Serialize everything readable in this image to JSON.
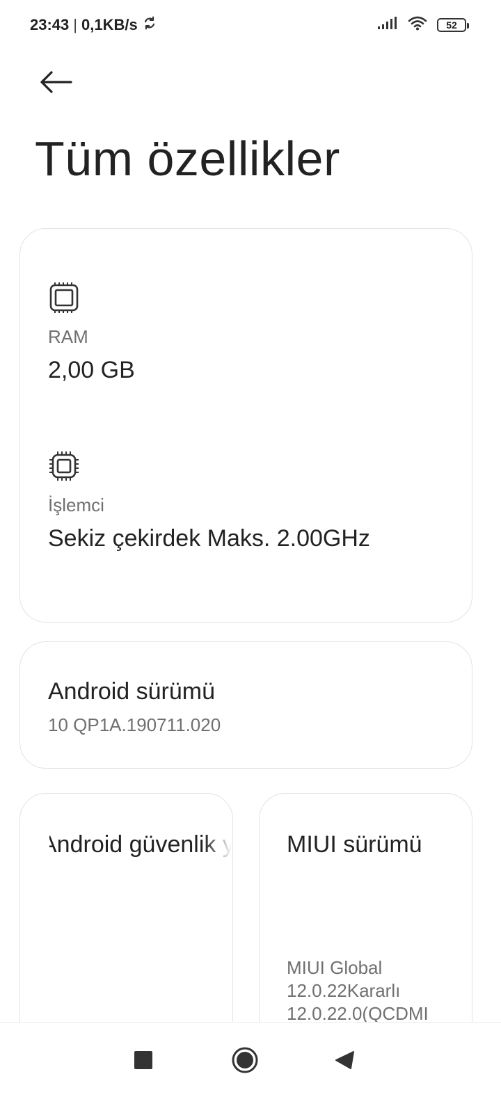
{
  "status_bar": {
    "time": "23:43",
    "net_speed": "0,1KB/s",
    "sync_icon": "sync-icon",
    "signal_icon": "signal-icon",
    "wifi_icon": "wifi-icon",
    "battery_level": "52"
  },
  "header": {
    "back_icon": "arrow-left-icon",
    "title": "Tüm özellikler"
  },
  "specs": {
    "ram": {
      "icon": "memory-chip-icon",
      "label": "RAM",
      "value": "2,00 GB"
    },
    "cpu": {
      "icon": "processor-icon",
      "label": "İşlemci",
      "value": "Sekiz çekirdek Maks. 2.00GHz"
    }
  },
  "android_version": {
    "title": "Android sürümü",
    "value": "10 QP1A.190711.020"
  },
  "security_patch": {
    "title": "Android güvenlik yaması"
  },
  "miui_version": {
    "title": "MIUI sürümü",
    "value_lines": [
      "MIUI Global",
      "12.0.22Kararlı",
      "12.0.22.0(QCDMI"
    ]
  },
  "nav_bar": {
    "recents_icon": "square-recents-icon",
    "home_icon": "circle-home-icon",
    "back_icon": "triangle-back-icon"
  },
  "colors": {
    "background": "#ffffff",
    "card_border": "#e3e3e3",
    "primary_text": "#222222",
    "secondary_text": "#707070"
  }
}
